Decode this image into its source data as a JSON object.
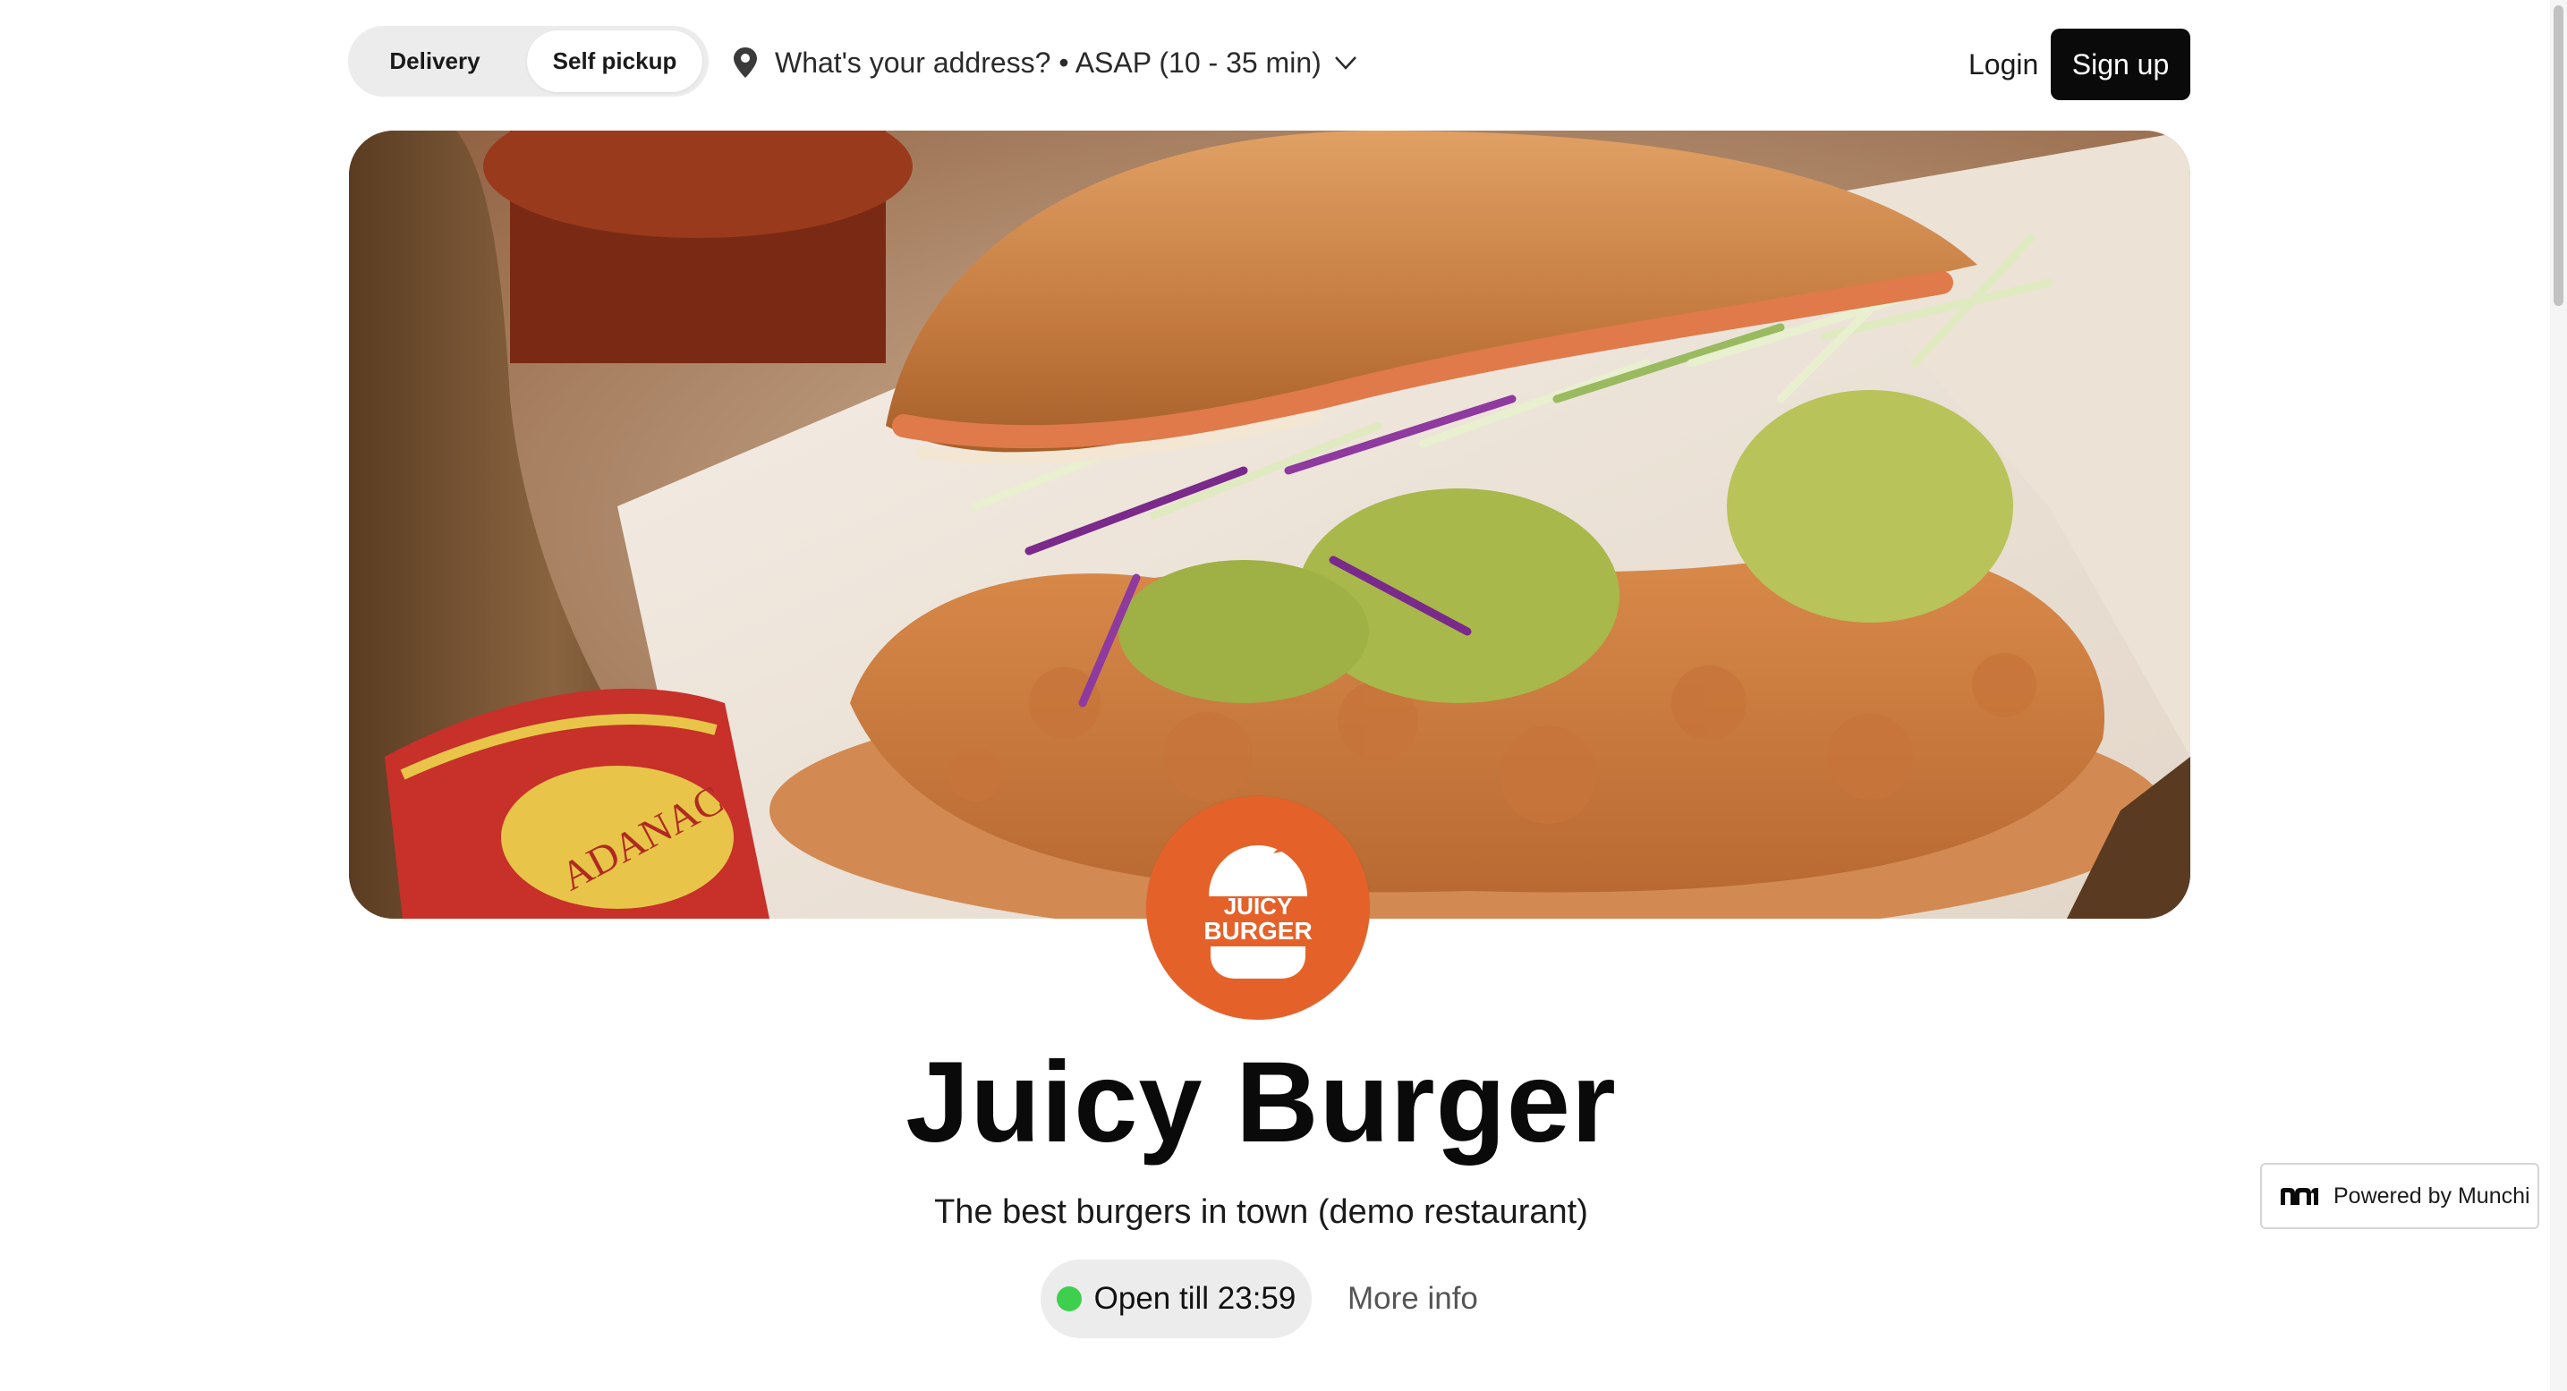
{
  "header": {
    "mode_toggle": {
      "options": [
        "Delivery",
        "Self pickup"
      ],
      "selected": "Self pickup"
    },
    "address": {
      "label": "What's your address? • ASAP (10 - 35 min)",
      "icon": "map-pin-icon"
    },
    "login_label": "Login",
    "signup_label": "Sign up"
  },
  "hero": {
    "image": "fried-chicken-burger-photo",
    "bottle_label": "ADANAC"
  },
  "restaurant": {
    "logo_text_line1": "JUICY",
    "logo_text_line2": "BURGER",
    "logo_color": "#e4622a",
    "name": "Juicy Burger",
    "tagline": "The best burgers in town (demo restaurant)",
    "status": "Open till 23:59",
    "status_color": "#3fcf4e",
    "more_info_label": "More info"
  },
  "badge": {
    "label": "Powered by Munchi",
    "icon": "munchi-logo-icon"
  }
}
